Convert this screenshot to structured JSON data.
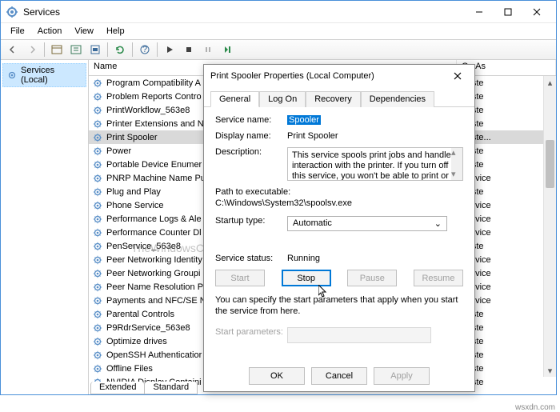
{
  "window": {
    "title": "Services",
    "menus": [
      "File",
      "Action",
      "View",
      "Help"
    ]
  },
  "tree": {
    "root": "Services (Local)"
  },
  "list": {
    "header_name": "Name",
    "header_logon": "On As",
    "bottom_tabs": [
      "Extended",
      "Standard"
    ],
    "rows": [
      {
        "name": "Program Compatibility A",
        "on": "Syste"
      },
      {
        "name": "Problem Reports Contro",
        "on": "Syste"
      },
      {
        "name": "PrintWorkflow_563e8",
        "on": "Syste"
      },
      {
        "name": "Printer Extensions and N",
        "on": "Syste"
      },
      {
        "name": "Print Spooler",
        "on": "Syste...",
        "selected": true
      },
      {
        "name": "Power",
        "on": "Syste"
      },
      {
        "name": "Portable Device Enumer",
        "on": "Syste"
      },
      {
        "name": "PNRP Machine Name Pu",
        "on": "Service"
      },
      {
        "name": "Plug and Play",
        "on": "Syste"
      },
      {
        "name": "Phone Service",
        "on": "Service"
      },
      {
        "name": "Performance Logs & Ale",
        "on": "Service"
      },
      {
        "name": "Performance Counter Dl",
        "on": "Service"
      },
      {
        "name": "PenService_563e8",
        "on": "Syste"
      },
      {
        "name": "Peer Networking Identity",
        "on": "Service"
      },
      {
        "name": "Peer Networking Groupi",
        "on": "Service"
      },
      {
        "name": "Peer Name Resolution Pl",
        "on": "Service"
      },
      {
        "name": "Payments and NFC/SE N",
        "on": "Service"
      },
      {
        "name": "Parental Controls",
        "on": "Syste"
      },
      {
        "name": "P9RdrService_563e8",
        "on": "Syste"
      },
      {
        "name": "Optimize drives",
        "on": "Syste"
      },
      {
        "name": "OpenSSH Authenticatior",
        "on": "Syste"
      },
      {
        "name": "Offline Files",
        "on": "Syste"
      },
      {
        "name": "NVIDIA Display Containi",
        "on": "Syste"
      }
    ]
  },
  "dialog": {
    "title": "Print Spooler Properties (Local Computer)",
    "tabs": [
      "General",
      "Log On",
      "Recovery",
      "Dependencies"
    ],
    "labels": {
      "service_name": "Service name:",
      "display_name": "Display name:",
      "description": "Description:",
      "path": "Path to executable:",
      "startup": "Startup type:",
      "status": "Service status:",
      "start_params": "Start parameters:"
    },
    "values": {
      "service_name": "Spooler",
      "display_name": "Print Spooler",
      "description": "This service spools print jobs and handles interaction with the printer.  If you turn off this service, you won't be able to print or see your printers",
      "path": "C:\\Windows\\System32\\spoolsv.exe",
      "startup": "Automatic",
      "status": "Running",
      "help": "You can specify the start parameters that apply when you start the service from here."
    },
    "buttons": {
      "start": "Start",
      "stop": "Stop",
      "pause": "Pause",
      "resume": "Resume",
      "ok": "OK",
      "cancel": "Cancel",
      "apply": "Apply"
    }
  },
  "watermark": "TheWindowsClub",
  "credit": "wsxdn.com"
}
